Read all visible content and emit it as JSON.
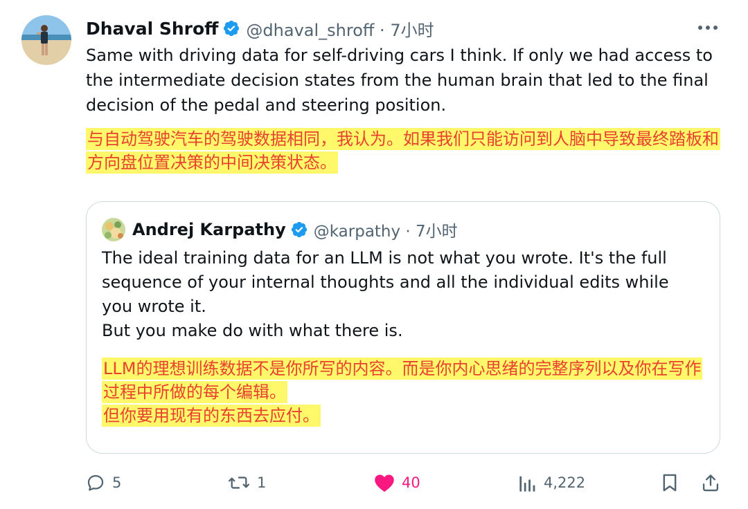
{
  "post": {
    "author_name": "Dhaval Shroff",
    "handle_time": "@dhaval_shroff · 7小时",
    "body": "Same with driving data for self-driving cars I think. If only we had access to the intermediate decision states from the human brain that led to the final decision of the pedal and steering position.",
    "translation": "与自动驾驶汽车的驾驶数据相同，我认为。如果我们只能访问到人脑中导致最终踏板和方向盘位置决策的中间决策状态。"
  },
  "quote": {
    "author_name": "Andrej Karpathy",
    "handle_time": "@karpathy · 7小时",
    "body_line1": "The ideal training data for an LLM is not what you wrote. It's the full sequence of your internal thoughts and all the individual edits while you wrote it.",
    "body_line2": "But you make do with what there is.",
    "translation_line1": "LLM的理想训练数据不是你所写的内容。而是你内心思绪的完整序列以及你在写作过程中所做的每个编辑。",
    "translation_line2": "但你要用现有的东西去应付。"
  },
  "actions": {
    "replies": "5",
    "reposts": "1",
    "likes": "40",
    "views": "4,222"
  },
  "colors": {
    "verified": "#1d9bf0",
    "like": "#f91880",
    "translation_text": "#e8412f",
    "highlight": "#fff86a",
    "secondary_text": "#536471"
  },
  "icons": [
    "more-icon",
    "verified-badge-icon",
    "reply-icon",
    "repost-icon",
    "like-heart-icon",
    "views-icon",
    "bookmark-icon",
    "share-icon"
  ]
}
